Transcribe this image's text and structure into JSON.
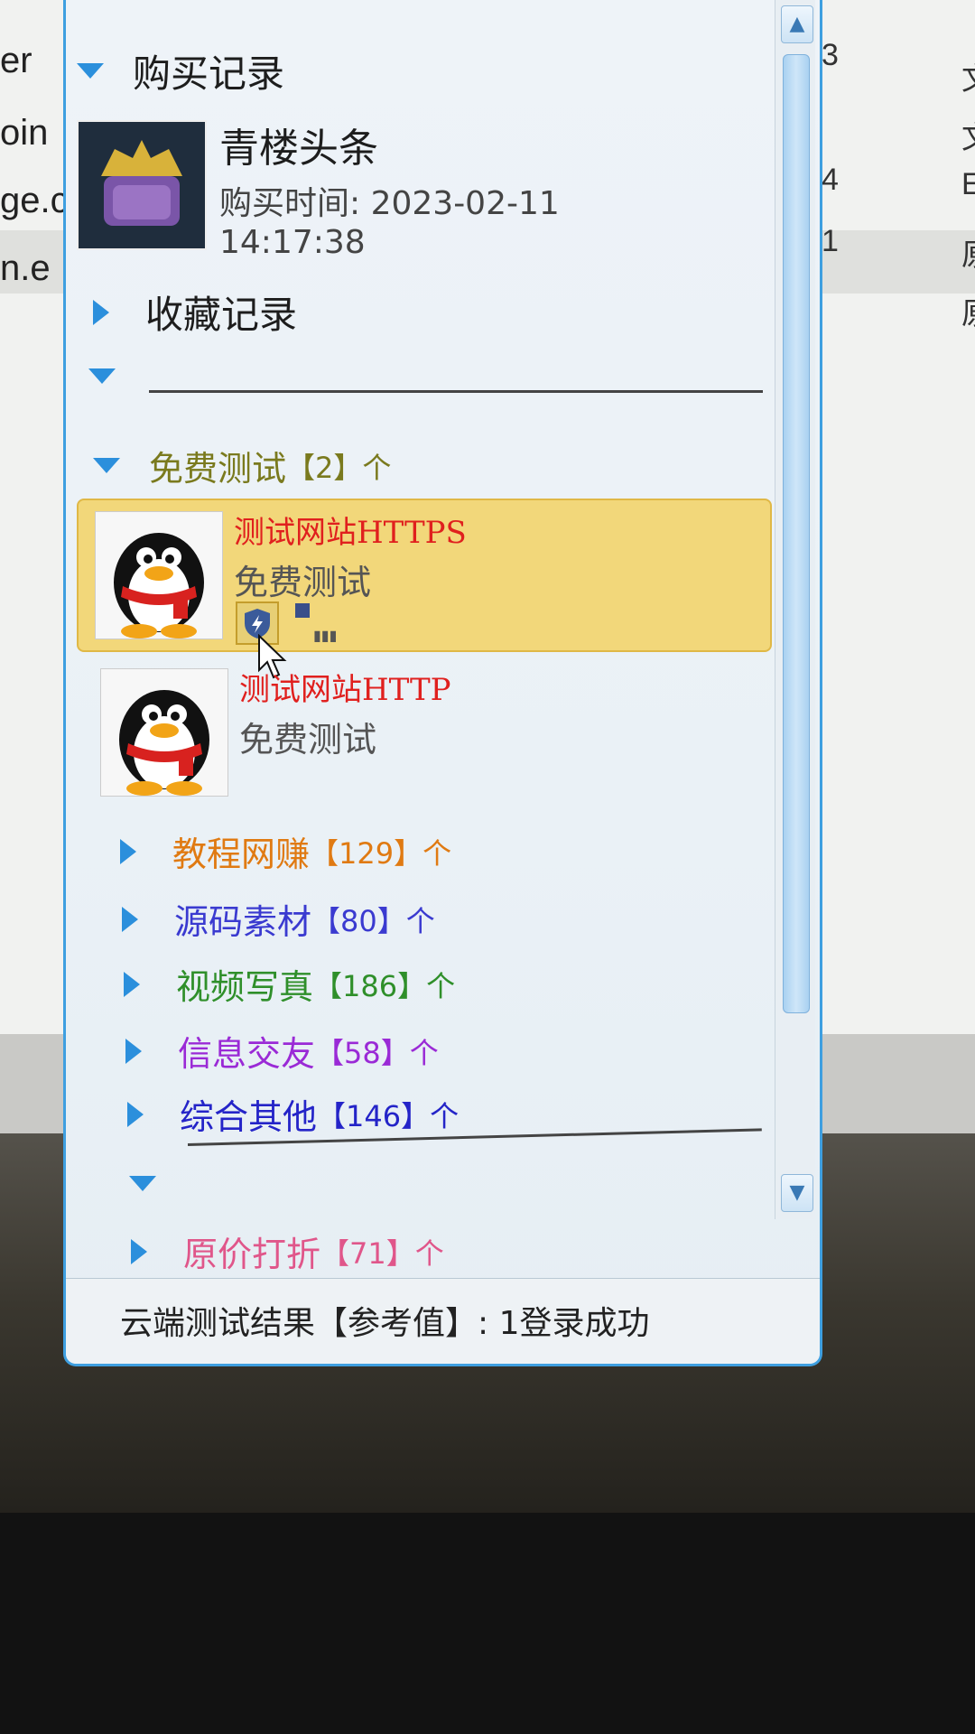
{
  "background": {
    "left_fragments": [
      "er",
      "oin",
      "ge.c",
      "n.e"
    ],
    "numbers": [
      "3",
      "4",
      "1"
    ],
    "right_fragments": [
      "文",
      "文",
      "E",
      "原",
      "原"
    ]
  },
  "panel": {
    "purchase": {
      "header": "购买记录",
      "item": {
        "title": "青楼头条",
        "time": "购买时间: 2023-02-11 14:17:38"
      }
    },
    "favorites": {
      "header": "收藏记录"
    },
    "free_test": {
      "label": "免费测试",
      "count": "【2】个",
      "color": "#7a7a1e",
      "items": [
        {
          "name": "测试网站HTTPS",
          "desc": "免费测试",
          "selected": true
        },
        {
          "name": "测试网站HTTP",
          "desc": "免费测试",
          "selected": false
        }
      ]
    },
    "categories": [
      {
        "label": "教程网赚",
        "count": "【129】个",
        "color": "#e07a12"
      },
      {
        "label": "源码素材",
        "count": "【80】个",
        "color": "#3a3ad0"
      },
      {
        "label": "视频写真",
        "count": "【186】个",
        "color": "#2f8f2a"
      },
      {
        "label": "信息交友",
        "count": "【58】个",
        "color": "#9a2ad6"
      },
      {
        "label": "综合其他",
        "count": "【146】个",
        "color": "#2424c8"
      }
    ],
    "discount": {
      "label": "原价打折",
      "count": "【71】个",
      "color": "#e0568a"
    },
    "status_text": "云端测试结果【参考值】: 1登录成功"
  },
  "colors": {
    "accent": "#2b8fdc",
    "selection": "#f2d77a",
    "contact_name": "#e0201e"
  }
}
